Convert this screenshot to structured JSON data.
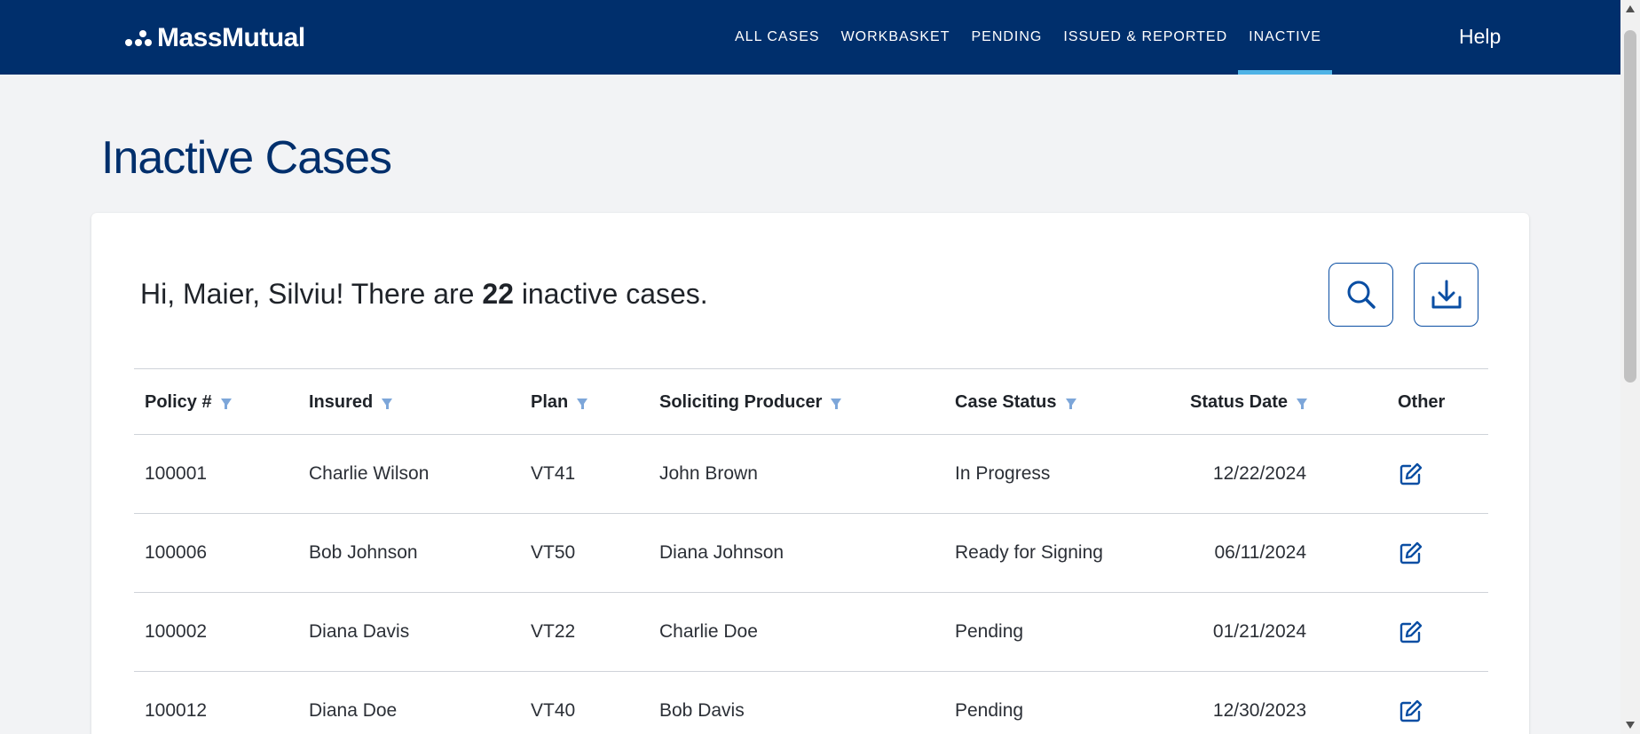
{
  "header": {
    "brand": "MassMutual",
    "nav": [
      {
        "label": "ALL CASES",
        "active": false
      },
      {
        "label": "WORKBASKET",
        "active": false
      },
      {
        "label": "PENDING",
        "active": false
      },
      {
        "label": "ISSUED & REPORTED",
        "active": false
      },
      {
        "label": "INACTIVE",
        "active": true
      }
    ],
    "help_label": "Help"
  },
  "page": {
    "title": "Inactive Cases"
  },
  "summary": {
    "prefix": "Hi, Maier, Silviu! There are",
    "count": "22",
    "suffix": "inactive cases."
  },
  "actions": {
    "search_icon": "search-icon",
    "download_icon": "download-icon"
  },
  "table": {
    "columns": [
      "Policy #",
      "Insured",
      "Plan",
      "Soliciting Producer",
      "Case Status",
      "Status Date",
      "Other"
    ],
    "rows": [
      {
        "policy": "100001",
        "insured": "Charlie Wilson",
        "plan": "VT41",
        "producer": "John Brown",
        "status": "In Progress",
        "date": "12/22/2024"
      },
      {
        "policy": "100006",
        "insured": "Bob Johnson",
        "plan": "VT50",
        "producer": "Diana Johnson",
        "status": "Ready for Signing",
        "date": "06/11/2024"
      },
      {
        "policy": "100002",
        "insured": "Diana Davis",
        "plan": "VT22",
        "producer": "Charlie Doe",
        "status": "Pending",
        "date": "01/21/2024"
      },
      {
        "policy": "100012",
        "insured": "Diana Doe",
        "plan": "VT40",
        "producer": "Bob Davis",
        "status": "Pending",
        "date": "12/30/2023"
      }
    ]
  },
  "colors": {
    "brand_navy": "#002f6c",
    "active_underline": "#4fb3e6",
    "action_blue": "#0a4ea3"
  }
}
